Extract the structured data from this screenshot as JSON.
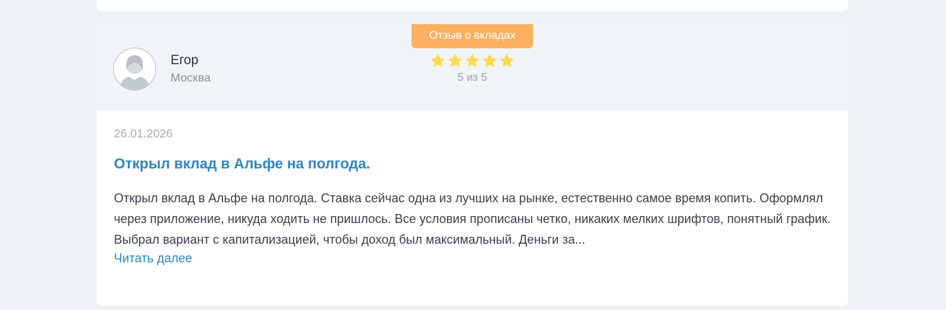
{
  "review": {
    "category_badge": "Отзыв о вкладах",
    "author": {
      "name": "Егор",
      "city": "Москва",
      "avatar_icon": "user-silhouette-icon"
    },
    "rating": {
      "value": 5,
      "max": 5,
      "text": "5 из 5",
      "star_icon": "star-icon",
      "star_color": "#ffd84d"
    },
    "date": "26.01.2026",
    "title": "Открыл вклад в Альфе на полгода.",
    "text": "Открыл вклад в Альфе на полгода. Ставка сейчас одна из лучших на рынке, естественно самое время копить. Оформлял через приложение, никуда ходить не пришлось. Все условия прописаны четко, никаких мелких шрифтов, понятный график. Выбрал вариант с капитализацией, чтобы доход был максимальный. Деньги за...",
    "read_more_label": "Читать далее"
  },
  "colors": {
    "badge": "#fbb05f",
    "link": "#2e86c1",
    "page_background": "#eff2f5"
  }
}
